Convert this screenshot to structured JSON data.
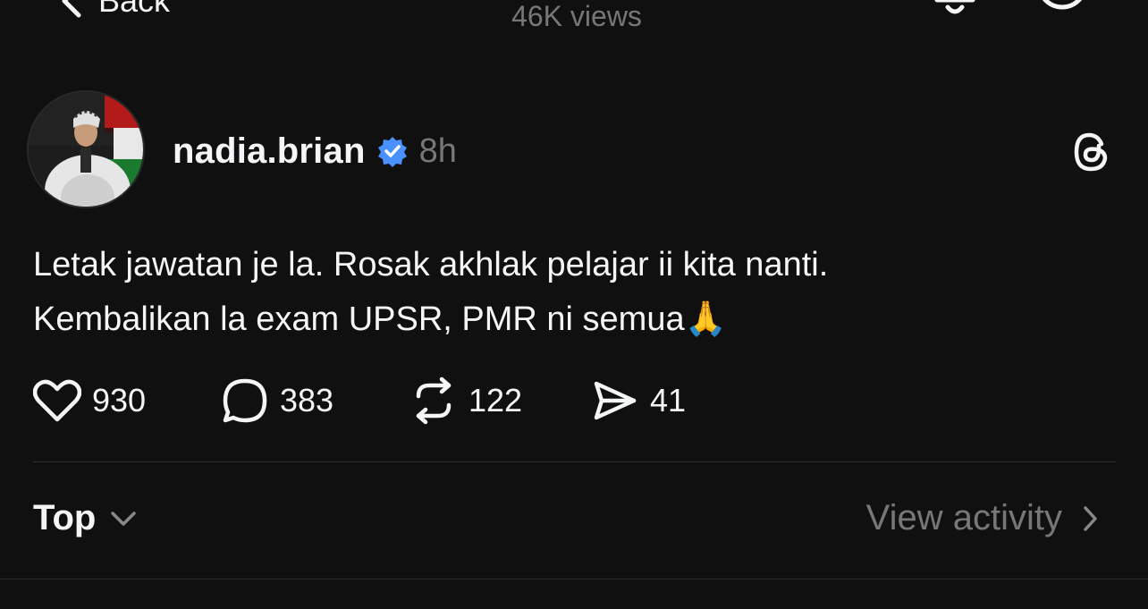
{
  "topbar": {
    "back_label": "Back",
    "views_label": "46K views",
    "bell_icon": "bell-icon",
    "more_icon": "circle-more-icon"
  },
  "post": {
    "username": "nadia.brian",
    "time": "8h",
    "verified_color": "#4a90ff",
    "text_lines": [
      "Letak jawatan je la. Rosak akhlak pelajar ii kita nanti.",
      "Kembalikan la exam UPSR, PMR ni semua"
    ],
    "emoji": "🙏"
  },
  "actions": {
    "likes": "930",
    "replies": "383",
    "reposts": "122",
    "shares": "41"
  },
  "sort": {
    "label": "Top"
  },
  "activity": {
    "label": "View activity"
  },
  "colors": {
    "background": "#101010",
    "text": "#f3f5f7",
    "muted": "#777777",
    "verified": "#4a90ff"
  }
}
